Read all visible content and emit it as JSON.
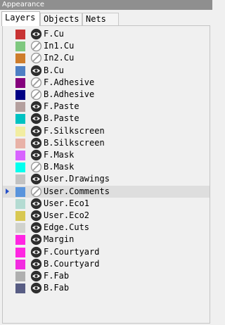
{
  "window": {
    "title": "Appearance"
  },
  "tabs": [
    {
      "label": "Layers",
      "active": true
    },
    {
      "label": "Objects",
      "active": false
    },
    {
      "label": "Nets",
      "active": false
    }
  ],
  "layers": [
    {
      "name": "F.Cu",
      "color": "#c83434",
      "visible": true
    },
    {
      "name": "In1.Cu",
      "color": "#7fc87f",
      "visible": false
    },
    {
      "name": "In2.Cu",
      "color": "#ce7d2c",
      "visible": false
    },
    {
      "name": "B.Cu",
      "color": "#4d7fc4",
      "visible": true
    },
    {
      "name": "F.Adhesive",
      "color": "#84007c",
      "visible": false
    },
    {
      "name": "B.Adhesive",
      "color": "#000084",
      "visible": false
    },
    {
      "name": "F.Paste",
      "color": "#b4a09e",
      "visible": true
    },
    {
      "name": "B.Paste",
      "color": "#00c2c2",
      "visible": true
    },
    {
      "name": "F.Silkscreen",
      "color": "#f2eda1",
      "visible": true
    },
    {
      "name": "B.Silkscreen",
      "color": "#e8b2a7",
      "visible": true
    },
    {
      "name": "F.Mask",
      "color": "#d864ff",
      "visible": true
    },
    {
      "name": "B.Mask",
      "color": "#02ffee",
      "visible": false
    },
    {
      "name": "User.Drawings",
      "color": "#c2c2c2",
      "visible": true
    },
    {
      "name": "User.Comments",
      "color": "#5994dc",
      "visible": false,
      "selected": true
    },
    {
      "name": "User.Eco1",
      "color": "#b4dbd2",
      "visible": true
    },
    {
      "name": "User.Eco2",
      "color": "#d8c852",
      "visible": true
    },
    {
      "name": "Edge.Cuts",
      "color": "#d0d2cd",
      "visible": true
    },
    {
      "name": "Margin",
      "color": "#ff26e2",
      "visible": true
    },
    {
      "name": "F.Courtyard",
      "color": "#ff26e2",
      "visible": true
    },
    {
      "name": "B.Courtyard",
      "color": "#f22ce0",
      "visible": true
    },
    {
      "name": "F.Fab",
      "color": "#afafaf",
      "visible": true
    },
    {
      "name": "B.Fab",
      "color": "#585d84",
      "visible": true
    }
  ],
  "icons": {
    "visible": "eye-icon",
    "hidden": "eye-hidden-icon",
    "current_layer": "current-layer-arrow-icon"
  }
}
